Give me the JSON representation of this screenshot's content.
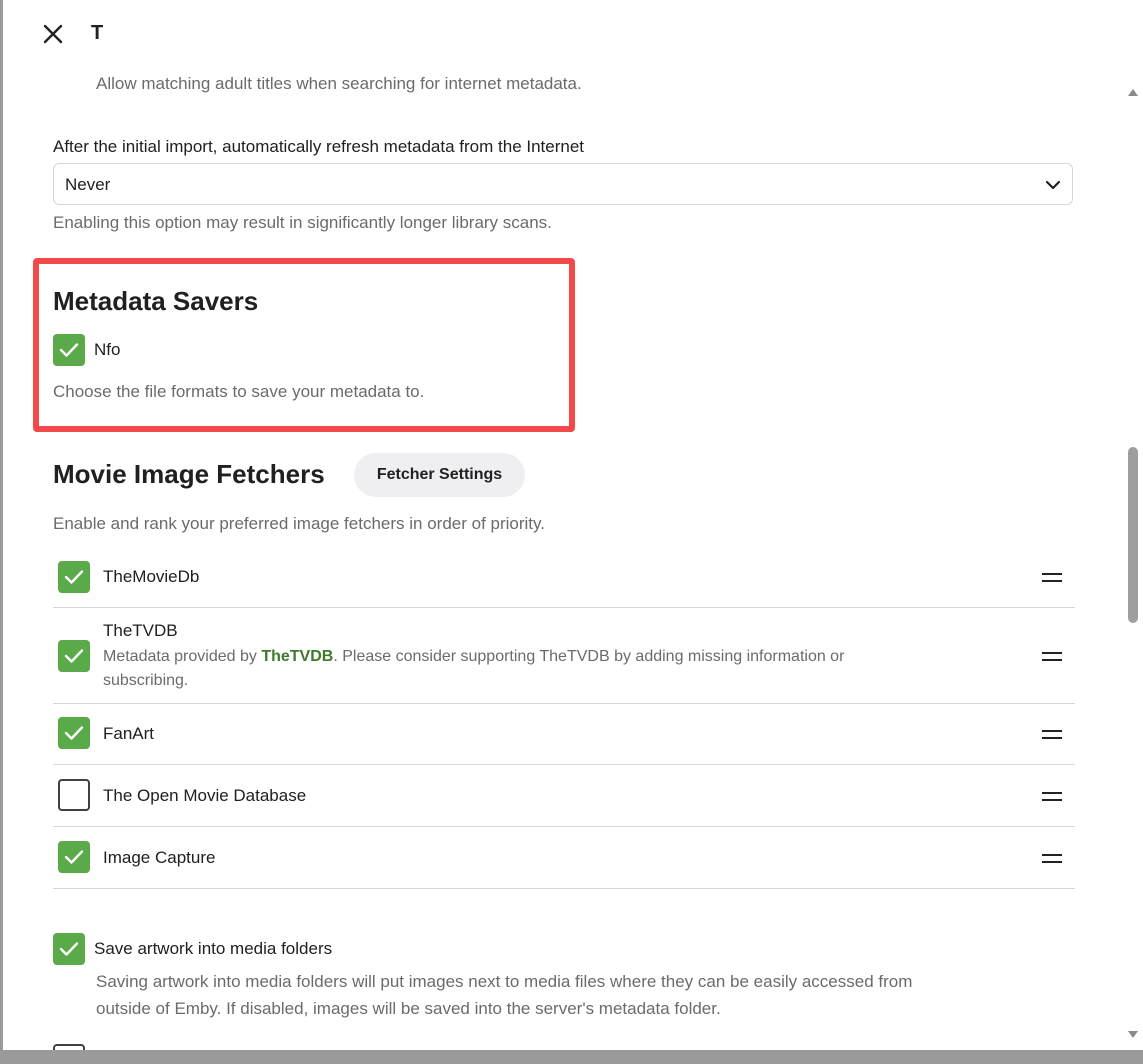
{
  "dialog": {
    "title": "T"
  },
  "adult": {
    "description": "Allow matching adult titles when searching for internet metadata."
  },
  "refresh": {
    "label": "After the initial import, automatically refresh metadata from the Internet",
    "value": "Never",
    "hint": "Enabling this option may result in significantly longer library scans."
  },
  "savers": {
    "heading": "Metadata Savers",
    "items": [
      {
        "label": "Nfo",
        "checked": true
      }
    ],
    "hint": "Choose the file formats to save your metadata to."
  },
  "image_fetchers": {
    "heading": "Movie Image Fetchers",
    "settings_button": "Fetcher Settings",
    "hint": "Enable and rank your preferred image fetchers in order of priority.",
    "items": [
      {
        "label": "TheMovieDb",
        "checked": true
      },
      {
        "label": "TheTVDB",
        "checked": true,
        "desc_prefix": "Metadata provided by ",
        "desc_link": "TheTVDB",
        "desc_suffix": ". Please consider supporting TheTVDB by adding missing information or",
        "desc_line2": "subscribing."
      },
      {
        "label": "FanArt",
        "checked": true
      },
      {
        "label": "The Open Movie Database",
        "checked": false
      },
      {
        "label": "Image Capture",
        "checked": true
      }
    ]
  },
  "artwork": {
    "label": "Save artwork into media folders",
    "checked": true,
    "desc_line1": "Saving artwork into media folders will put images next to media files where they can be easily accessed from",
    "desc_line2": "outside of Emby. If disabled, images will be saved into the server's metadata folder."
  },
  "colors": {
    "accent": "#5aaa4a",
    "highlight": "#f2494a",
    "link": "#3f7a2b"
  }
}
